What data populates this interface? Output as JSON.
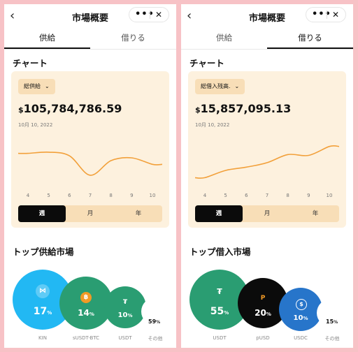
{
  "left": {
    "title": "市場概要",
    "more": "•••",
    "close": "✕",
    "back": "‹",
    "tabs": [
      {
        "label": "供給",
        "active": true
      },
      {
        "label": "借りる",
        "active": false
      }
    ],
    "chart_section": "チャート",
    "dropdown": "総供給",
    "currency": "$",
    "amount": "105,784,786.59",
    "date": "10月 10, 2022",
    "x_ticks": [
      "4",
      "5",
      "6",
      "7",
      "8",
      "9",
      "10"
    ],
    "periods": [
      {
        "label": "週",
        "active": true
      },
      {
        "label": "月",
        "active": false
      },
      {
        "label": "年",
        "active": false
      }
    ],
    "markets_section": "トップ供給市場",
    "markets": [
      {
        "name": "KIN",
        "icon": "kin-icon",
        "glyph": "⋈",
        "pct": "17",
        "color": "#22b8f3"
      },
      {
        "name": "sUSDT-BTC",
        "icon": "susdt-btc-icon",
        "glyph": "฿",
        "pct": "14",
        "color": "#2a9d72"
      },
      {
        "name": "USDT",
        "icon": "usdt-icon",
        "glyph": "₮",
        "pct": "10",
        "color": "#2a9d72"
      }
    ],
    "other": {
      "name": "その他",
      "pct": "59"
    }
  },
  "right": {
    "title": "市場概要",
    "more": "•••",
    "close": "✕",
    "back": "‹",
    "tabs": [
      {
        "label": "供給",
        "active": false
      },
      {
        "label": "借りる",
        "active": true
      }
    ],
    "chart_section": "チャート",
    "dropdown": "総借入残高.",
    "currency": "$",
    "amount": "15,857,095.13",
    "date": "10月 10, 2022",
    "x_ticks": [
      "4",
      "5",
      "6",
      "7",
      "8",
      "9",
      "10"
    ],
    "periods": [
      {
        "label": "週",
        "active": true
      },
      {
        "label": "月",
        "active": false
      },
      {
        "label": "年",
        "active": false
      }
    ],
    "markets_section": "トップ借入市場",
    "markets": [
      {
        "name": "USDT",
        "icon": "usdt-icon",
        "glyph": "₮",
        "pct": "55",
        "color": "#2a9d72"
      },
      {
        "name": "pUSD",
        "icon": "pusd-icon",
        "glyph": "P",
        "pct": "20",
        "color": "#0b0b0b"
      },
      {
        "name": "USDC",
        "icon": "usdc-icon",
        "glyph": "$",
        "pct": "10",
        "color": "#2775ca"
      }
    ],
    "other": {
      "name": "その他",
      "pct": "15"
    }
  },
  "colors": {
    "accent": "#f2a03a",
    "card": "#fdf1de",
    "chip": "#f8deb7",
    "background": "#f7c2c6"
  },
  "chart_data": [
    {
      "type": "line",
      "categories": [
        "4",
        "5",
        "6",
        "7",
        "8",
        "9",
        "10"
      ],
      "values": [
        0.8,
        0.83,
        0.74,
        0.26,
        0.62,
        0.69,
        0.53
      ],
      "series_color": "#f2a03a"
    },
    {
      "type": "line",
      "categories": [
        "4",
        "5",
        "6",
        "7",
        "8",
        "9",
        "10"
      ],
      "values": [
        0.2,
        0.38,
        0.46,
        0.57,
        0.77,
        0.75,
        0.97
      ],
      "series_color": "#f2a03a"
    }
  ]
}
